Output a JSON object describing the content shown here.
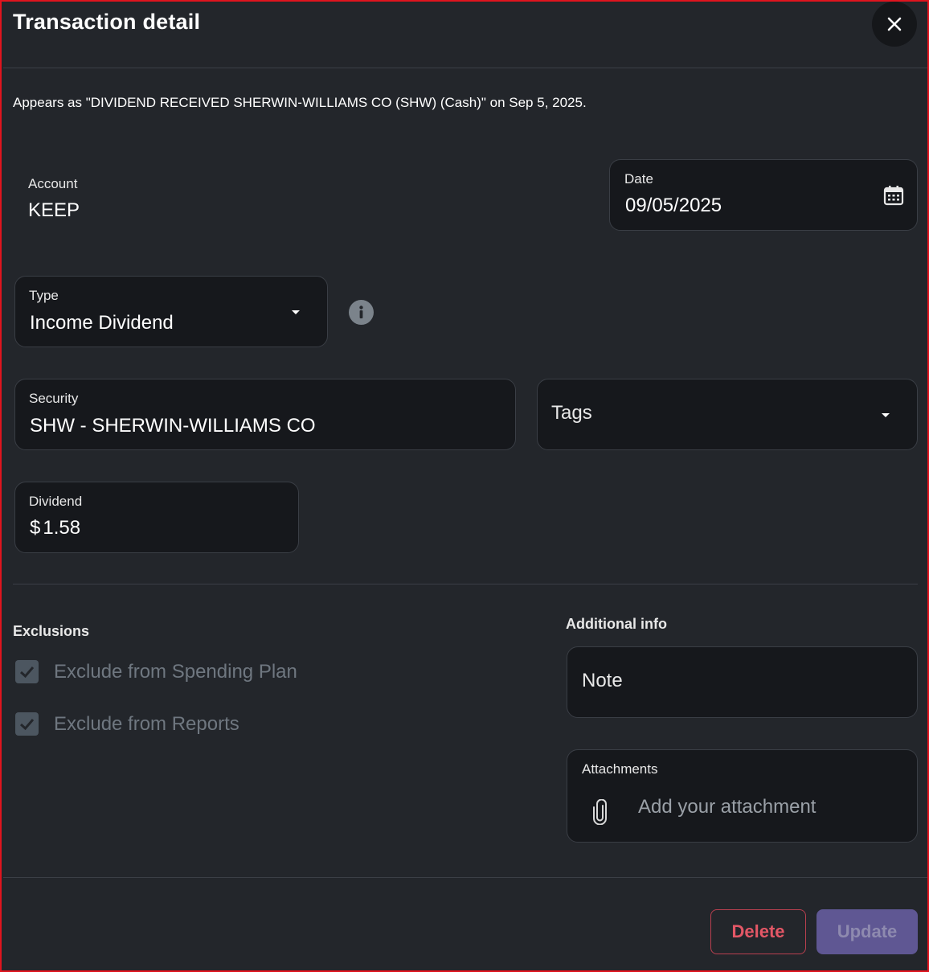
{
  "dialog": {
    "title": "Transaction detail",
    "appears_as": "Appears as \"DIVIDEND RECEIVED SHERWIN-WILLIAMS CO (SHW) (Cash)\" on Sep 5, 2025."
  },
  "account": {
    "label": "Account",
    "value": "KEEP"
  },
  "date": {
    "label": "Date",
    "value": "09/05/2025"
  },
  "type": {
    "label": "Type",
    "value": "Income Dividend"
  },
  "security": {
    "label": "Security",
    "value": "SHW - SHERWIN-WILLIAMS CO"
  },
  "tags": {
    "placeholder": "Tags"
  },
  "dividend": {
    "label": "Dividend",
    "currency": "$",
    "amount": "1.58"
  },
  "exclusions": {
    "label": "Exclusions",
    "items": [
      {
        "label": "Exclude from Spending Plan",
        "checked": true
      },
      {
        "label": "Exclude from Reports",
        "checked": true
      }
    ]
  },
  "additional_info": {
    "label": "Additional info",
    "note_placeholder": "Note",
    "attachments_label": "Attachments",
    "attachments_placeholder": "Add your attachment"
  },
  "footer": {
    "delete_label": "Delete",
    "update_label": "Update"
  },
  "icons": {
    "close": "close-icon",
    "calendar": "calendar-icon",
    "dropdown": "caret-down-icon",
    "info": "info-icon",
    "check": "check-icon",
    "attachment": "paperclip-icon"
  },
  "colors": {
    "background": "#23262b",
    "field": "#16181c",
    "border_accent": "#e0141e",
    "delete": "#e35766",
    "update_bg": "#5f5793"
  }
}
